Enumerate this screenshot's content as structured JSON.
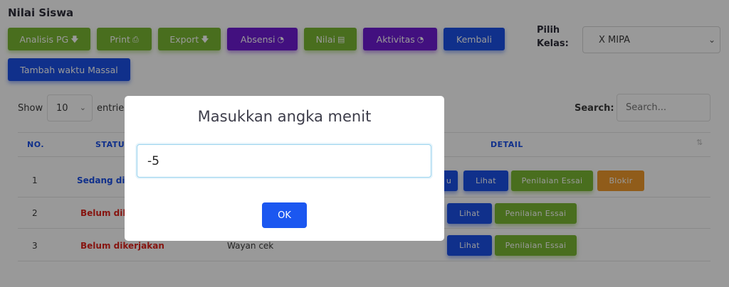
{
  "page": {
    "title": "Nilai Siswa"
  },
  "toolbar": {
    "buttons": [
      {
        "label": "Analisis PG",
        "icon": "file-download-icon",
        "glyph": "🡇"
      },
      {
        "label": "Print",
        "icon": "print-icon",
        "glyph": "⎙"
      },
      {
        "label": "Export",
        "icon": "file-download-icon",
        "glyph": "🡇"
      },
      {
        "label": "Absensi",
        "icon": "clock-icon",
        "glyph": "◔"
      },
      {
        "label": "Nilai",
        "icon": "list-alt-icon",
        "glyph": "▤"
      },
      {
        "label": "Aktivitas",
        "icon": "clock-icon",
        "glyph": "◔"
      },
      {
        "label": "Kembali"
      },
      {
        "label": "Tambah waktu Massal"
      }
    ]
  },
  "kelas": {
    "label_line1": "Pilih",
    "label_line2": "Kelas:",
    "selected": "X MIPA"
  },
  "entries": {
    "show_label": "Show",
    "value": "10",
    "entries_label": "entries"
  },
  "search": {
    "label": "Search:",
    "placeholder": "Search..."
  },
  "table": {
    "headers": {
      "no": "NO.",
      "status": "STATUS",
      "detail": "DETAIL"
    },
    "rows": [
      {
        "no": "1",
        "status": "Sedang dik",
        "name": "",
        "buttons": [
          "u",
          "Lihat",
          "Penilaian Essai",
          "Blokir"
        ]
      },
      {
        "no": "2",
        "status": "Belum dike",
        "name": "",
        "buttons": [
          "Lihat",
          "Penilaian Essai"
        ]
      },
      {
        "no": "3",
        "status": "Belum dikerjakan",
        "name": "Wayan cek",
        "buttons": [
          "Lihat",
          "Penilaian Essai"
        ]
      }
    ]
  },
  "modal": {
    "title": "Masukkan angka menit",
    "input_value": "-5",
    "ok_label": "OK"
  },
  "colors": {
    "green": "#7ab833",
    "purple": "#6f1bd4",
    "blue": "#1b50e8",
    "orange": "#f09a2c",
    "red": "#e0231c"
  }
}
